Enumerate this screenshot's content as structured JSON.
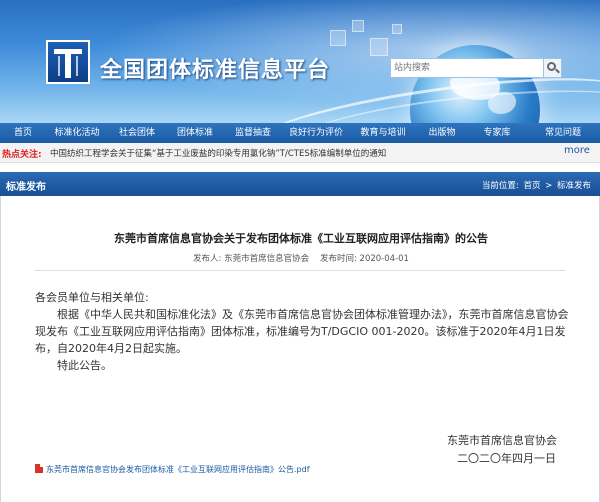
{
  "header": {
    "site_title": "全国团体标准信息平台",
    "search_placeholder": "站内搜索"
  },
  "nav": {
    "items": [
      "首页",
      "标准化活动",
      "社会团体",
      "团体标准",
      "监督抽查",
      "良好行为评价",
      "教育与培训",
      "出版物",
      "专家库",
      "常见问题"
    ]
  },
  "hot": {
    "label": "热点关注:",
    "text": "中国纺织工程学会关于征集“基于工业废盐的印染专用氯化钠”T/CTES标准编制单位的通知",
    "more": "more"
  },
  "section": {
    "title": "标准发布",
    "crumb_prefix": "当前位置:",
    "crumb_home": "首页",
    "crumb_sep": ">",
    "crumb_current": "标准发布"
  },
  "article": {
    "title": "东莞市首席信息官协会关于发布团体标准《工业互联网应用评估指南》的公告",
    "publisher_label": "发布人:",
    "publisher": "东莞市首席信息官协会",
    "time_label": "发布时间:",
    "time": "2020-04-01",
    "salutation": "各会员单位与相关单位:",
    "paragraph": "根据《中华人民共和国标准化法》及《东莞市首席信息官协会团体标准管理办法》，东莞市首席信息官协会现发布《工业互联网应用评估指南》团体标准，标准编号为T/DGCIO 001-2020。该标准于2020年4月1日发布，自2020年4月2日起实施。",
    "closing": "特此公告。",
    "signature_org": "东莞市首席信息官协会",
    "signature_date": "二〇二〇年四月一日",
    "attachment": "东莞市首席信息官协会发布团体标准《工业互联网应用评估指南》公告.pdf"
  },
  "colors": {
    "nav_bg": "#1a5aa3",
    "hot_label": "#dd2222",
    "link": "#1a5aa3"
  }
}
